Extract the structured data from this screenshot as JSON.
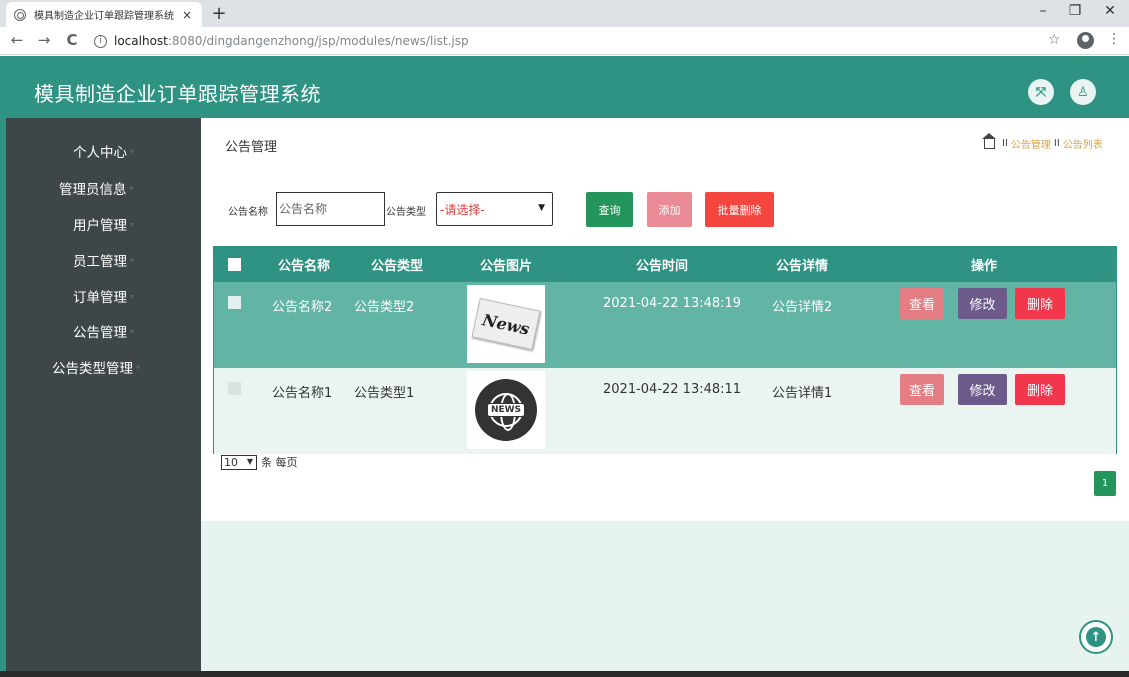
{
  "browser": {
    "tab_title": "模具制造企业订单跟踪管理系统",
    "tab_close": "×",
    "new_tab": "+",
    "url_host": "localhost",
    "url_rest": ":8080/dingdangenzhong/jsp/modules/news/list.jsp",
    "info": "i",
    "back": "←",
    "forward": "→",
    "reload": "C",
    "star": "☆",
    "kebab": "⋮",
    "minimize": "–",
    "maximize": "❐",
    "close": "✕"
  },
  "app": {
    "title": "模具制造企业订单跟踪管理系统",
    "fullscreen_icon": "⤧",
    "user_icon": "♙"
  },
  "sidebar": {
    "items": [
      {
        "label": "个人中心"
      },
      {
        "label": "管理员信息"
      },
      {
        "label": "用户管理"
      },
      {
        "label": "员工管理"
      },
      {
        "label": "订单管理"
      },
      {
        "label": "公告管理"
      },
      {
        "label": "公告类型管理"
      }
    ],
    "caret": "▾"
  },
  "page": {
    "title": "公告管理",
    "breadcrumb": [
      "公告管理",
      "公告列表"
    ],
    "breadcrumb_sep": "II"
  },
  "search": {
    "name_label": "公告名称",
    "name_placeholder": "公告名称",
    "type_label": "公告类型",
    "type_selected": "-请选择-",
    "query_button": "查询",
    "add_button": "添加",
    "batch_delete_button": "批量删除"
  },
  "table": {
    "columns": [
      "公告名称",
      "公告类型",
      "公告图片",
      "公告时间",
      "公告详情",
      "操作"
    ],
    "rows": [
      {
        "name": "公告名称2",
        "type": "公告类型2",
        "image": "News",
        "time": "2021-04-22 13:48:19",
        "detail": "公告详情2"
      },
      {
        "name": "公告名称1",
        "type": "公告类型1",
        "image": "NEWS",
        "time": "2021-04-22 13:48:11",
        "detail": "公告详情1"
      }
    ],
    "actions": {
      "view": "查看",
      "edit": "修改",
      "delete": "删除"
    }
  },
  "pager": {
    "page_size": "10",
    "page_size_suffix": "条 每页",
    "current_page": "1"
  },
  "colors": {
    "primary": "#2e9383",
    "sidebar": "#3d4649",
    "row_selected": "#62b4a4",
    "query": "#23955a",
    "add": "#e98a94",
    "batch_delete": "#f5453f",
    "view": "#e57d85",
    "edit": "#6b5a8a",
    "delete": "#f2374d"
  },
  "icons": {
    "back_to_top": "↑"
  }
}
